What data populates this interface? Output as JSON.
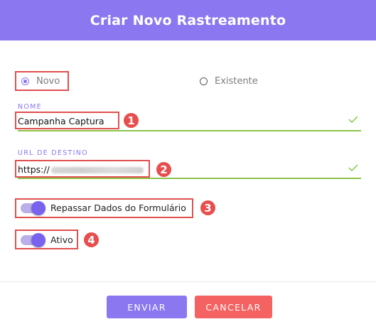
{
  "dialog": {
    "title": "Criar Novo Rastreamento"
  },
  "radio": {
    "novo": "Novo",
    "existente": "Existente"
  },
  "nome": {
    "label": "NOME",
    "value": "Campanha Captura"
  },
  "url": {
    "label": "URL DE DESTINO",
    "value_prefix": "https://"
  },
  "toggles": {
    "repassar": "Repassar Dados do Formulário",
    "ativo": "Ativo"
  },
  "markers": [
    "1",
    "2",
    "3",
    "4"
  ],
  "buttons": {
    "enviar": "ENVIAR",
    "cancelar": "CANCELAR"
  },
  "colors": {
    "accent": "#8b77f0",
    "success": "#8bc34a",
    "danger": "#f56262",
    "marker": "#e84e4e"
  }
}
